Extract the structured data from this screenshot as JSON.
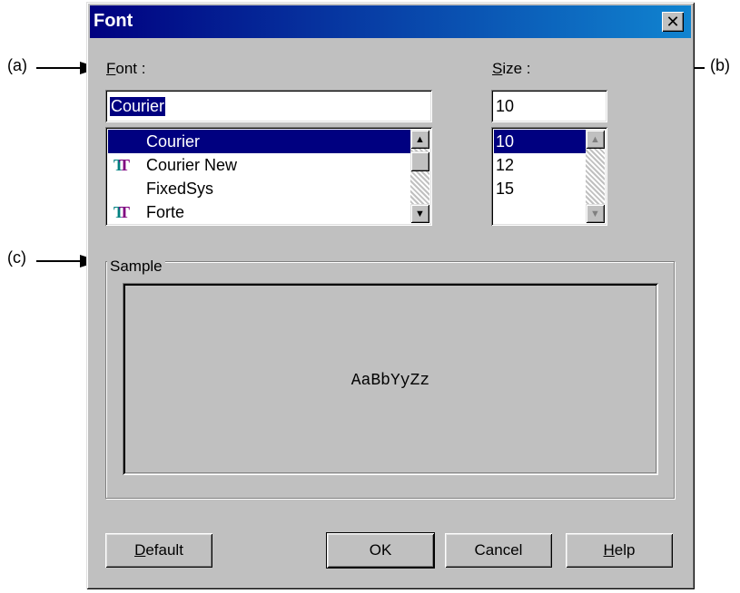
{
  "annotations": {
    "a": "(a)",
    "b": "(b)",
    "c": "(c)"
  },
  "dialog": {
    "title": "Font",
    "close_glyph": "✕"
  },
  "font_label": {
    "mnemonic": "F",
    "rest": "ont :"
  },
  "size_label": {
    "mnemonic": "S",
    "rest": "ize :"
  },
  "font_input": {
    "value": "Courier"
  },
  "size_input": {
    "value": "10"
  },
  "font_list": {
    "items": [
      {
        "label": "Courier",
        "selected": true,
        "truetype": false
      },
      {
        "label": "Courier New",
        "selected": false,
        "truetype": true
      },
      {
        "label": "FixedSys",
        "selected": false,
        "truetype": false
      },
      {
        "label": "Forte",
        "selected": false,
        "truetype": true
      }
    ]
  },
  "size_list": {
    "items": [
      {
        "label": "10",
        "selected": true
      },
      {
        "label": "12",
        "selected": false
      },
      {
        "label": "15",
        "selected": false
      }
    ]
  },
  "sample": {
    "label": "Sample",
    "text": "AaBbYyZz"
  },
  "buttons": {
    "default": {
      "mnemonic": "D",
      "rest": "efault"
    },
    "ok": "OK",
    "cancel": "Cancel",
    "help": {
      "mnemonic": "H",
      "rest": "elp"
    }
  },
  "icons": {
    "truetype": "truetype-font-icon",
    "scroll_up": "scroll-up-arrow-icon",
    "scroll_down": "scroll-down-arrow-icon"
  }
}
